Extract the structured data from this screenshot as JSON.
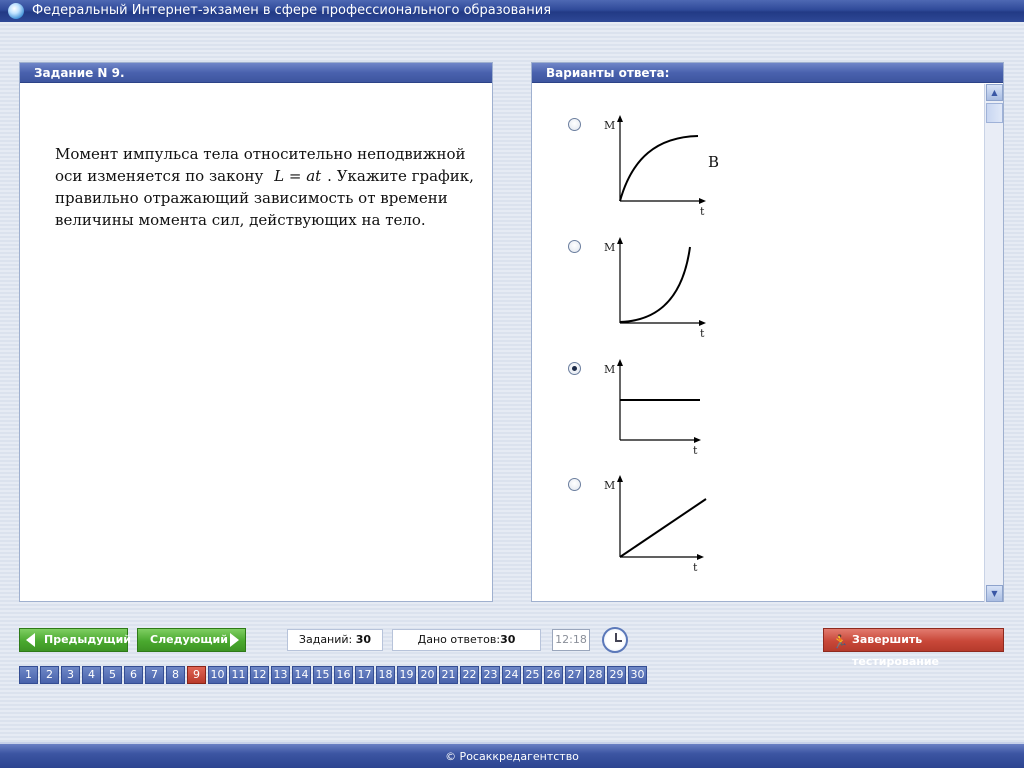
{
  "window": {
    "title": "Федеральный Интернет-экзамен в сфере профессионального образования"
  },
  "task": {
    "header": "Задание N 9.",
    "text_part1": "Момент импульса тела относительно неподвижной оси изменяется по закону",
    "formula": "L = at",
    "text_part2": ". Укажите график, правильно отражающий зависимость от времени величины момента сил, действующих на тело."
  },
  "answers": {
    "header": "Варианты ответа:",
    "axis_y": "M",
    "axis_x": "t",
    "options": [
      {
        "shape": "saturation",
        "selected": false,
        "letter": "B"
      },
      {
        "shape": "growing",
        "selected": false,
        "letter": ""
      },
      {
        "shape": "constant",
        "selected": true,
        "letter": ""
      },
      {
        "shape": "linear",
        "selected": false,
        "letter": ""
      }
    ]
  },
  "controls": {
    "prev_label": "Предыдущий",
    "next_label": "Следующий",
    "tasks_label": "Заданий:",
    "tasks_count": "30",
    "answered_label": "Дано ответов:",
    "answered_count": "30",
    "time": "12:18",
    "finish_label": "Завершить тестирование"
  },
  "pager": {
    "pages": [
      "1",
      "2",
      "3",
      "4",
      "5",
      "6",
      "7",
      "8",
      "9",
      "10",
      "11",
      "12",
      "13",
      "14",
      "15",
      "16",
      "17",
      "18",
      "19",
      "20",
      "21",
      "22",
      "23",
      "24",
      "25",
      "26",
      "27",
      "28",
      "29",
      "30"
    ],
    "active": "9"
  },
  "footer": {
    "text": "© Росаккредагентство"
  },
  "colors": {
    "accent": "#3d559f",
    "active_page": "#b93a2b",
    "nav_green": "#4aa92f",
    "finish_red": "#c94839"
  }
}
